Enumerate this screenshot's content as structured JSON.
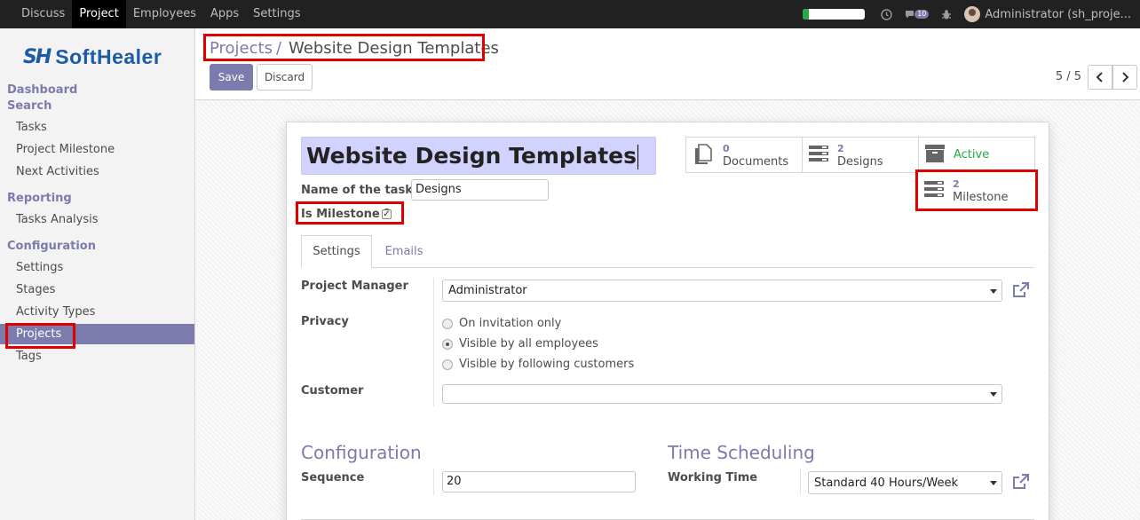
{
  "topbar": {
    "menu": [
      "Discuss",
      "Project",
      "Employees",
      "Apps",
      "Settings"
    ],
    "active_menu": "Project",
    "progress_fraction": 0.1,
    "messages_count": "10",
    "user": "Administrator (sh_proje..."
  },
  "sidebar": {
    "logo_mark": "SH",
    "logo_text": "SoftHealer",
    "sections": {
      "dashboard": "Dashboard",
      "search": "Search",
      "reporting": "Reporting",
      "configuration": "Configuration"
    },
    "items": {
      "tasks": "Tasks",
      "project_milestone": "Project Milestone",
      "next_activities": "Next Activities",
      "tasks_analysis": "Tasks Analysis",
      "settings": "Settings",
      "stages": "Stages",
      "activity_types": "Activity Types",
      "projects": "Projects",
      "tags": "Tags"
    }
  },
  "control": {
    "breadcrumb_parent": "Projects",
    "breadcrumb_sep": "/",
    "breadcrumb_current": "Website Design Templates",
    "save_label": "Save",
    "discard_label": "Discard",
    "pager": "5 / 5"
  },
  "form": {
    "name": "Website Design Templates",
    "tasks_label": "Name of the tasks :",
    "tasks_value": "Designs",
    "milestone_label": "Is Milestone ?",
    "milestone_checked": true,
    "smart_buttons": {
      "documents": {
        "count": "0",
        "label": "Documents"
      },
      "designs": {
        "count": "2",
        "label": "Designs"
      },
      "active": {
        "label": "Active"
      },
      "milestone": {
        "count": "2",
        "label": "Milestone"
      }
    },
    "tabs": [
      "Settings",
      "Emails"
    ],
    "project_manager_label": "Project Manager",
    "project_manager_value": "Administrator",
    "privacy_label": "Privacy",
    "privacy_options": [
      "On invitation only",
      "Visible by all employees",
      "Visible by following customers"
    ],
    "privacy_selected": "Visible by all employees",
    "customer_label": "Customer",
    "customer_value": "",
    "config_title": "Configuration",
    "sequence_label": "Sequence",
    "sequence_value": "20",
    "time_title": "Time Scheduling",
    "working_time_label": "Working Time",
    "working_time_value": "Standard 40 Hours/Week"
  }
}
